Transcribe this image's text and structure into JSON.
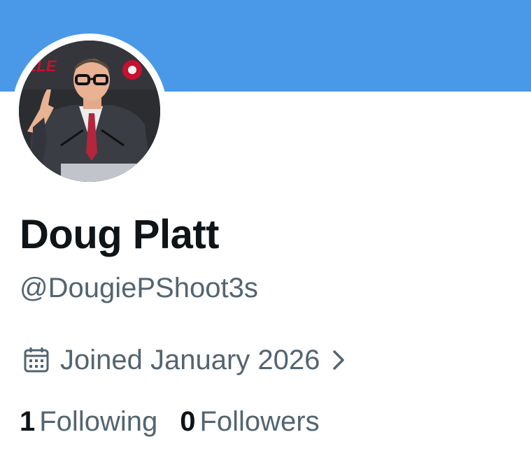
{
  "profile": {
    "display_name": "Doug Platt",
    "handle": "@DougiePShoot3s",
    "joined": "Joined January 2026",
    "stats": {
      "following_count": "1",
      "following_label": "Following",
      "followers_count": "0",
      "followers_label": "Followers"
    },
    "avatar_backdrop_text": "LLE"
  },
  "colors": {
    "banner": "#4a99e9",
    "primary_text": "#0f1419",
    "secondary_text": "#536471",
    "background": "#ffffff"
  },
  "icons": {
    "joined": "calendar-icon",
    "joined_more": "chevron-right-icon"
  }
}
